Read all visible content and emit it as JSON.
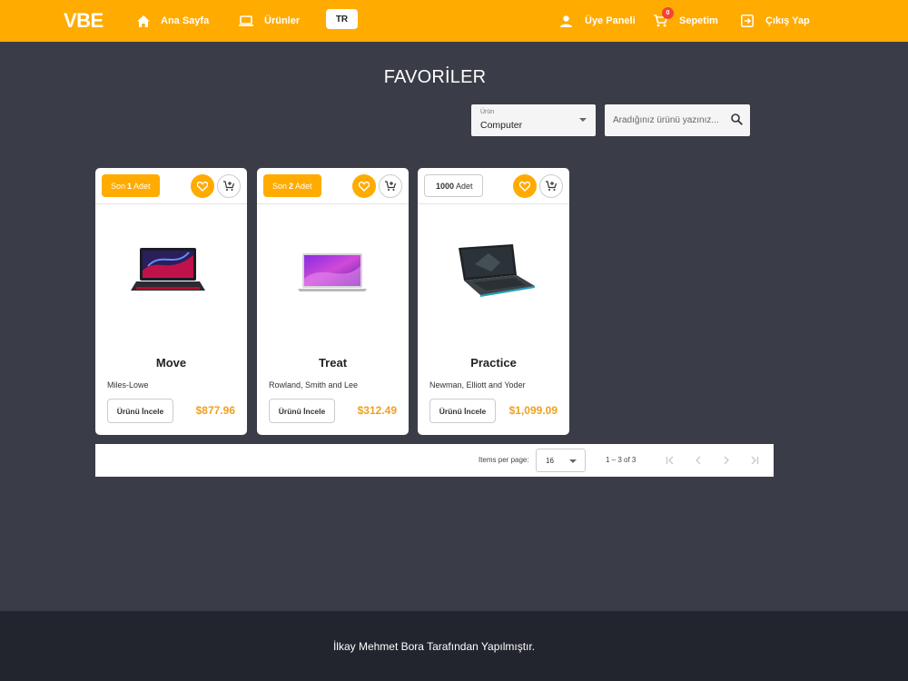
{
  "header": {
    "logo": "VBE",
    "nav": {
      "home": "Ana Sayfa",
      "products": "Ürünler",
      "language": "TR",
      "member_panel": "Üye Paneli",
      "cart": "Sepetim",
      "cart_count": "0",
      "logout": "Çıkış Yap"
    }
  },
  "page": {
    "title": "FAVORİLER"
  },
  "filters": {
    "category_label": "Ürün",
    "category_value": "Computer",
    "search_placeholder": "Aradığınız ürünü yazınız..."
  },
  "products": [
    {
      "stock_prefix": "Son",
      "stock_count": "1",
      "stock_suffix": "Adet",
      "name": "Move",
      "brand": "Miles-Lowe",
      "inspect_label": "Ürünü İncele",
      "price": "$877.96",
      "image": "gaming-laptop-red"
    },
    {
      "stock_prefix": "Son",
      "stock_count": "2",
      "stock_suffix": "Adet",
      "name": "Treat",
      "brand": "Rowland, Smith and Lee",
      "inspect_label": "Ürünü İncele",
      "price": "$312.49",
      "image": "macbook-laptop"
    },
    {
      "stock_prefix": "",
      "stock_count": "1000",
      "stock_suffix": "Adet",
      "name": "Practice",
      "brand": "Newman, Elliott and Yoder",
      "inspect_label": "Ürünü İncele",
      "price": "$1,099.09",
      "image": "gaming-laptop-black"
    }
  ],
  "paginator": {
    "items_per_page_label": "Items per page:",
    "items_per_page": "16",
    "range": "1 – 3 of 3"
  },
  "footer": {
    "text": "İlkay Mehmet Bora Tarafından Yapılmıştır."
  },
  "colors": {
    "accent": "#ffab00",
    "background": "#3a3d47",
    "footer": "#22252d",
    "price": "#f0a020",
    "badge": "#f44336"
  }
}
